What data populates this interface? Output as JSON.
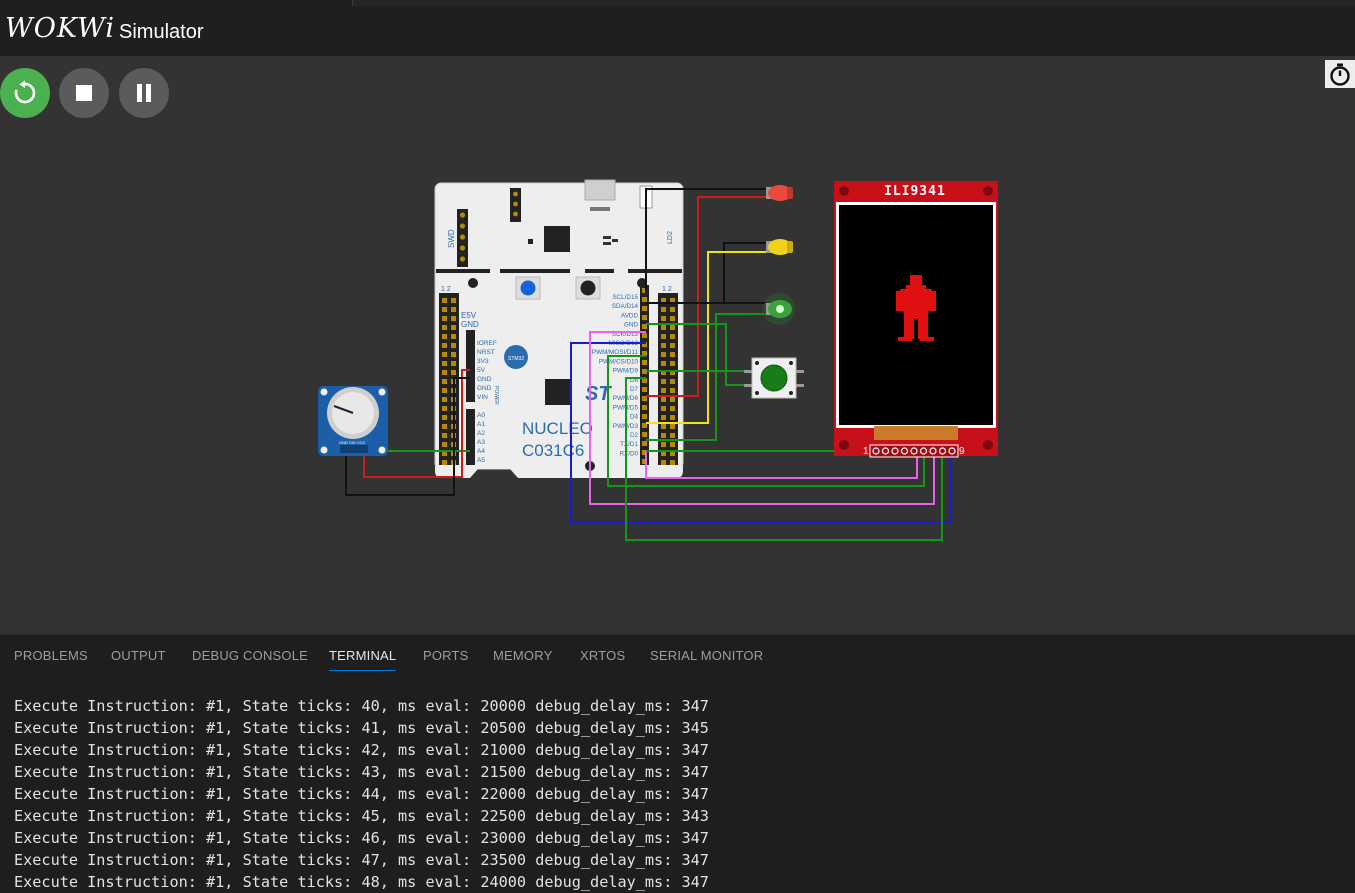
{
  "header": {
    "logo": "WOKWi",
    "title": "Simulator"
  },
  "controls": {
    "restart_icon": "restart-icon",
    "stop_icon": "stop-icon",
    "pause_icon": "pause-icon",
    "timer_icon": "stopwatch-icon"
  },
  "board": {
    "name_line1": "NUCLEO",
    "name_line2": "C031C6",
    "swd": "SWD",
    "ld2": "LD2",
    "header_nums": "1 2",
    "power_header": [
      "E5V",
      "GND"
    ],
    "power_pins": [
      "IOREF",
      "NRST",
      "3V3",
      "5V",
      "GND",
      "GND",
      "VIN"
    ],
    "analog_pins": [
      "A0",
      "A1",
      "A2",
      "A3",
      "A4",
      "A5"
    ],
    "digital_pins": [
      "SCL/D15",
      "SDA/D14",
      "AVDD",
      "GND",
      "SCK/D13",
      "MISO/D12",
      "PWM/MOSI/D11",
      "PWM/CS/D10",
      "PWM/D9",
      "D8",
      "D7",
      "PWM/D6",
      "PWM/D5",
      "D4",
      "PWM/D3",
      "D2",
      "TX/D1",
      "RX/D0"
    ],
    "power_label": "POWER",
    "logo_text": "STM32"
  },
  "display": {
    "label": "ILI9341",
    "pin_first": "1",
    "pin_last": "9"
  },
  "pot": {
    "pins": "GND SIG VCC"
  },
  "panel": {
    "tabs": [
      "PROBLEMS",
      "OUTPUT",
      "DEBUG CONSOLE",
      "TERMINAL",
      "PORTS",
      "MEMORY",
      "XRTOS",
      "SERIAL MONITOR"
    ],
    "active_tab": "TERMINAL"
  },
  "terminal": {
    "lines": [
      "Execute Instruction: #1, State ticks: 40, ms eval: 20000 debug_delay_ms: 347",
      "Execute Instruction: #1, State ticks: 41, ms eval: 20500 debug_delay_ms: 345",
      "Execute Instruction: #1, State ticks: 42, ms eval: 21000 debug_delay_ms: 347",
      "Execute Instruction: #1, State ticks: 43, ms eval: 21500 debug_delay_ms: 347",
      "Execute Instruction: #1, State ticks: 44, ms eval: 22000 debug_delay_ms: 347",
      "Execute Instruction: #1, State ticks: 45, ms eval: 22500 debug_delay_ms: 343",
      "Execute Instruction: #1, State ticks: 46, ms eval: 23000 debug_delay_ms: 347",
      "Execute Instruction: #1, State ticks: 47, ms eval: 23500 debug_delay_ms: 347",
      "Execute Instruction: #1, State ticks: 48, ms eval: 24000 debug_delay_ms: 347"
    ]
  },
  "colors": {
    "wire_red": "#d11a1a",
    "wire_black": "#111111",
    "wire_yellow": "#f2e21b",
    "wire_green": "#169616",
    "wire_blue": "#1a1ad6",
    "wire_pink": "#ea62ea",
    "display_red": "#c8101a",
    "restart_green": "#4caf50",
    "tab_accent": "#0078d4"
  }
}
